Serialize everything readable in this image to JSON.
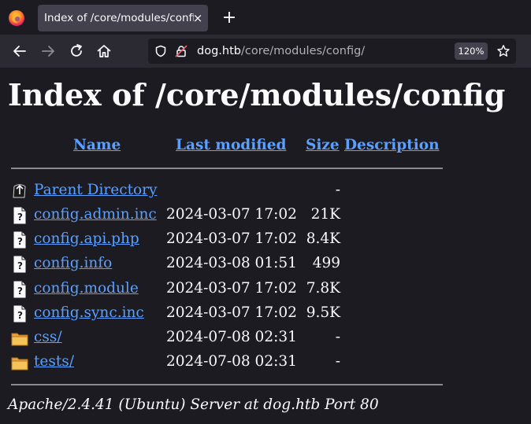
{
  "browser": {
    "tab_title": "Index of /core/modules/config",
    "tab_close": "×",
    "new_tab": "+",
    "url_host": "dog.htb",
    "url_path": "/core/modules/config/",
    "zoom": "120%"
  },
  "page": {
    "heading": "Index of /core/modules/config",
    "columns": {
      "name": "Name",
      "last_modified": "Last modified",
      "size": "Size",
      "description": "Description"
    },
    "rows": [
      {
        "icon": "parent-directory-icon",
        "name": "Parent Directory",
        "modified": "",
        "size": "-"
      },
      {
        "icon": "file-icon",
        "name": "config.admin.inc",
        "modified": "2024-03-07 17:02",
        "size": "21K"
      },
      {
        "icon": "file-icon",
        "name": "config.api.php",
        "modified": "2024-03-07 17:02",
        "size": "8.4K"
      },
      {
        "icon": "file-icon",
        "name": "config.info",
        "modified": "2024-03-08 01:51",
        "size": "499"
      },
      {
        "icon": "file-icon",
        "name": "config.module",
        "modified": "2024-03-07 17:02",
        "size": "7.8K"
      },
      {
        "icon": "file-icon",
        "name": "config.sync.inc",
        "modified": "2024-03-07 17:02",
        "size": "9.5K"
      },
      {
        "icon": "folder-icon",
        "name": "css/",
        "modified": "2024-07-08 02:31",
        "size": "-"
      },
      {
        "icon": "folder-icon",
        "name": "tests/",
        "modified": "2024-07-08 02:31",
        "size": "-"
      }
    ],
    "footer": "Apache/2.4.41 (Ubuntu) Server at dog.htb Port 80"
  },
  "colors": {
    "background": "#1c1b22",
    "link": "#5aa0ff",
    "text": "#fbfbfe",
    "toolbar": "#2b2a33"
  }
}
